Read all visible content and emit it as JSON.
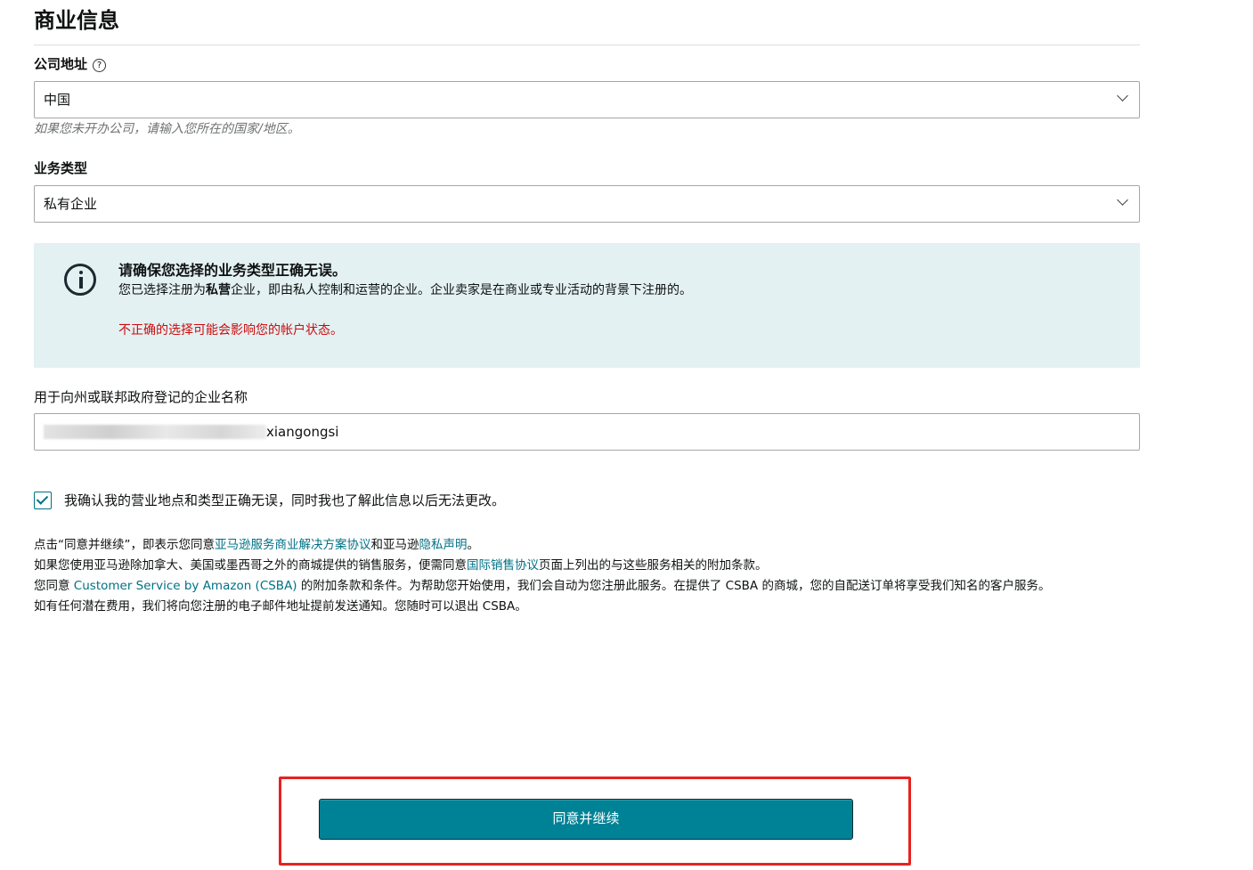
{
  "page": {
    "title": "商业信息"
  },
  "company_address": {
    "label": "公司地址",
    "help_icon_glyph": "?",
    "selected": "中国",
    "hint": "如果您未开办公司，请输入您所在的国家/地区。"
  },
  "business_type": {
    "label": "业务类型",
    "selected": "私有企业"
  },
  "alert": {
    "title": "请确保您选择的业务类型正确无误。",
    "body_prefix": "您已选择注册为",
    "body_highlight": "私营",
    "body_suffix": "企业，即由私人控制和运营的企业。企业卖家是在商业或专业活动的背景下注册的。",
    "warning": "不正确的选择可能会影响您的帐户状态。"
  },
  "business_name": {
    "label": "用于向州或联邦政府登记的企业名称",
    "value_visible": "xiangongsi"
  },
  "confirm": {
    "checked": true,
    "label": "我确认我的营业地点和类型正确无误，同时我也了解此信息以后无法更改。"
  },
  "legal": {
    "line1_a": "点击“同意并继续”，即表示您同意",
    "line1_link1": "亚马逊服务商业解决方案协议",
    "line1_b": "和亚马逊",
    "line1_link2": "隐私声明",
    "line1_c": "。",
    "line2_a": "如果您使用亚马逊除加拿大、美国或墨西哥之外的商城提供的销售服务，便需同意",
    "line2_link": "国际销售协议",
    "line2_b": "页面上列出的与这些服务相关的附加条款。",
    "line3_a": "您同意 ",
    "line3_link": "Customer Service by Amazon (CSBA)",
    "line3_b": " 的附加条款和条件。为帮助您开始使用，我们会自动为您注册此服务。在提供了 CSBA 的商城，您的自配送订单将享受我们知名的客户服务。",
    "line4": "如有任何潜在费用，我们将向您注册的电子邮件地址提前发送通知。您随时可以退出 CSBA。"
  },
  "cta": {
    "label": "同意并继续"
  },
  "colors": {
    "accent": "#008296",
    "link": "#007185",
    "warning": "#cc0c0c",
    "alert_bg": "#e3f1f3",
    "highlight_outline": "#e8211e"
  }
}
